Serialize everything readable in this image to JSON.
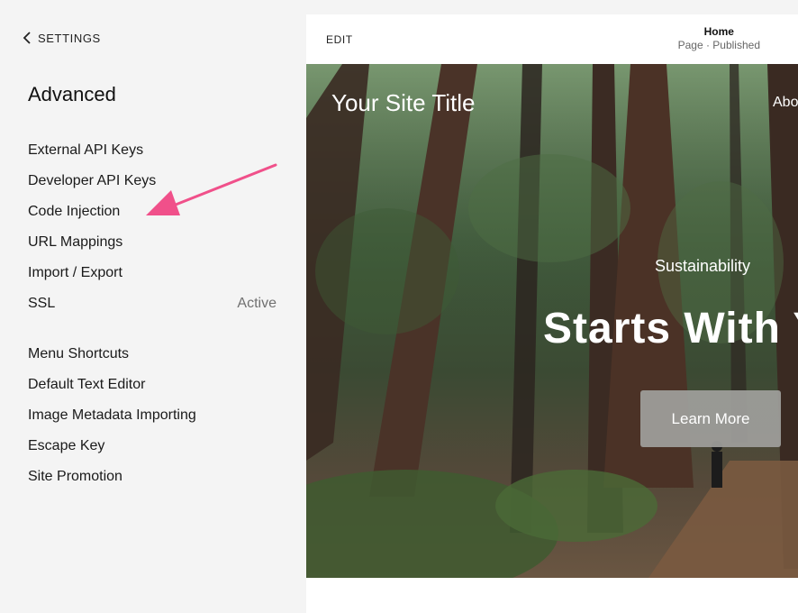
{
  "sidebar": {
    "back_label": "SETTINGS",
    "title": "Advanced",
    "items_group1": [
      {
        "label": "External API Keys",
        "status": ""
      },
      {
        "label": "Developer API Keys",
        "status": ""
      },
      {
        "label": "Code Injection",
        "status": ""
      },
      {
        "label": "URL Mappings",
        "status": ""
      },
      {
        "label": "Import / Export",
        "status": ""
      },
      {
        "label": "SSL",
        "status": "Active"
      }
    ],
    "items_group2": [
      {
        "label": "Menu Shortcuts"
      },
      {
        "label": "Default Text Editor"
      },
      {
        "label": "Image Metadata Importing"
      },
      {
        "label": "Escape Key"
      },
      {
        "label": "Site Promotion"
      }
    ]
  },
  "annotation": {
    "color": "#f0508a",
    "points_to": "Code Injection"
  },
  "preview": {
    "edit_label": "EDIT",
    "page_name": "Home",
    "page_status": "Page · Published",
    "site_title": "Your Site Title",
    "nav_about": "Abo",
    "eyebrow": "Sustainability",
    "headline": "Starts With Y",
    "cta_label": "Learn More"
  }
}
